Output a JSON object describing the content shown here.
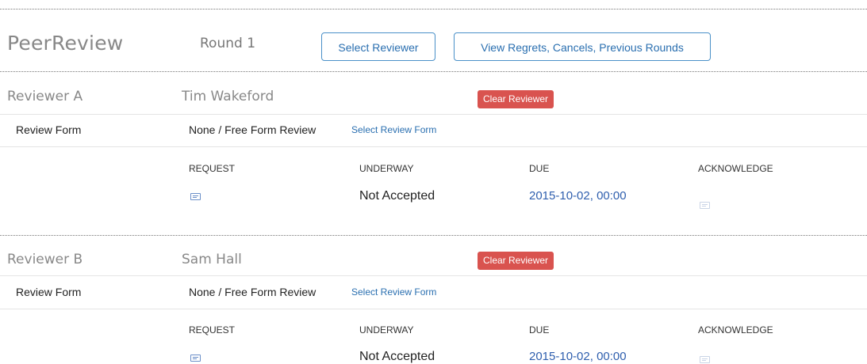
{
  "header": {
    "title": "PeerReview",
    "round": "Round 1",
    "select_reviewer": "Select Reviewer",
    "view_regrets": "View Regrets, Cancels, Previous Rounds"
  },
  "reviewers": [
    {
      "label": "Reviewer A",
      "name": "Tim Wakeford",
      "clear_label": "Clear Reviewer",
      "form_label": "Review Form",
      "form_value": "None / Free Form Review",
      "select_form": "Select Review Form",
      "columns": [
        "REQUEST",
        "UNDERWAY",
        "DUE",
        "ACKNOWLEDGE"
      ],
      "underway": "Not Accepted",
      "due": "2015-10-02, 00:00"
    },
    {
      "label": "Reviewer B",
      "name": "Sam Hall",
      "clear_label": "Clear Reviewer",
      "form_label": "Review Form",
      "form_value": "None / Free Form Review",
      "select_form": "Select Review Form",
      "columns": [
        "REQUEST",
        "UNDERWAY",
        "DUE",
        "ACKNOWLEDGE"
      ],
      "underway": "Not Accepted",
      "due": "2015-10-02, 00:00"
    }
  ],
  "icons": {
    "request": "envelope-icon",
    "acknowledge": "envelope-icon"
  },
  "colors": {
    "accent": "#2a6fb0",
    "danger": "#d9534f",
    "muted_text": "#888888"
  }
}
